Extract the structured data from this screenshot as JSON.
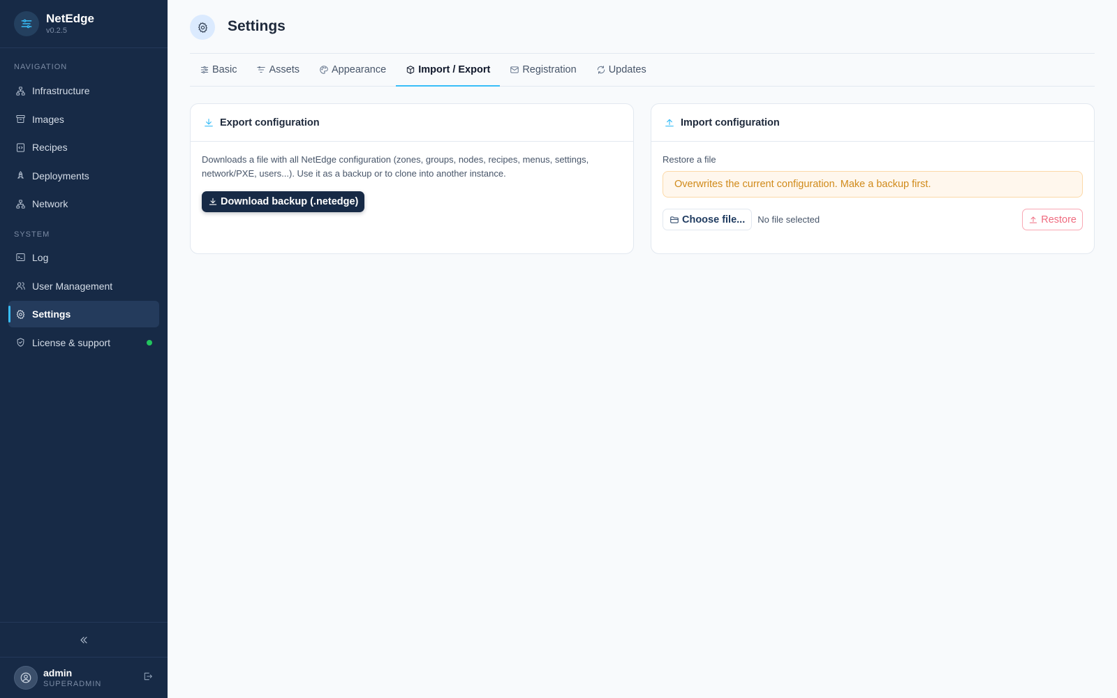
{
  "brand": {
    "name": "NetEdge",
    "version": "v0.2.5"
  },
  "sidebar": {
    "sections": [
      {
        "label": "NAVIGATION"
      },
      {
        "label": "SYSTEM"
      }
    ],
    "items": [
      {
        "label": "Infrastructure",
        "icon": "network-icon"
      },
      {
        "label": "Images",
        "icon": "archive-icon"
      },
      {
        "label": "Recipes",
        "icon": "code-file-icon"
      },
      {
        "label": "Deployments",
        "icon": "rocket-icon"
      },
      {
        "label": "Network",
        "icon": "network-icon"
      },
      {
        "label": "Log",
        "icon": "terminal-icon"
      },
      {
        "label": "User Management",
        "icon": "users-icon"
      },
      {
        "label": "Settings",
        "icon": "gear-icon",
        "active": true
      },
      {
        "label": "License & support",
        "icon": "shield-check-icon",
        "status": "online"
      }
    ]
  },
  "user": {
    "name": "admin",
    "role": "SUPERADMIN"
  },
  "header": {
    "title": "Settings"
  },
  "tabs": [
    {
      "label": "Basic"
    },
    {
      "label": "Assets"
    },
    {
      "label": "Appearance"
    },
    {
      "label": "Import / Export",
      "active": true
    },
    {
      "label": "Registration"
    },
    {
      "label": "Updates"
    }
  ],
  "export_card": {
    "title": "Export configuration",
    "description": "Downloads a file with all NetEdge configuration (zones, groups, nodes, recipes, menus, settings, network/PXE, users...). Use it as a backup or to clone into another instance.",
    "button": "Download backup (.netedge)"
  },
  "import_card": {
    "title": "Import configuration",
    "label": "Restore a file",
    "warning": "Overwrites the current configuration. Make a backup first.",
    "choose_button": "Choose file...",
    "file_status": "No file selected",
    "restore_button": "Restore"
  },
  "colors": {
    "sidebar_bg": "#172a46",
    "accent": "#38bdf8",
    "warning_text": "#d08a1a",
    "danger": "#ef6b7f",
    "status_online": "#22c55e"
  }
}
